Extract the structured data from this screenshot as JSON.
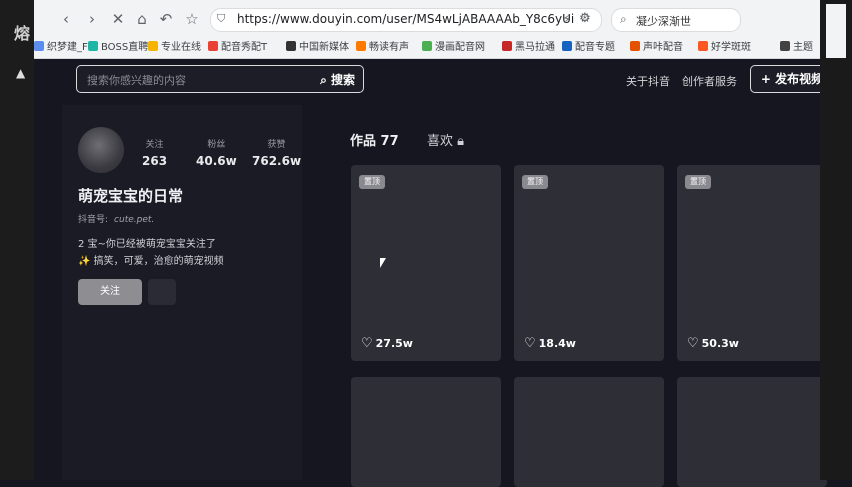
{
  "browser": {
    "url": "https://www.douyin.com/user/MS4wLjABAAAAb_Y8c6yUi",
    "search_text": "凝少深渐世",
    "left_title_glyph": "熔",
    "bookmarks": [
      {
        "label": "织梦建_F",
        "color": "#5b8def"
      },
      {
        "label": "BOSS直聘",
        "color": "#1db6a6"
      },
      {
        "label": "专业在线",
        "color": "#f4b400"
      },
      {
        "label": "配音秀配T",
        "color": "#e94235"
      },
      {
        "label": "中国新媒体",
        "color": "#333333"
      },
      {
        "label": "畅读有声",
        "color": "#ff7a00"
      },
      {
        "label": "漫画配音网",
        "color": "#4caf50"
      },
      {
        "label": "黑马拉通",
        "color": "#c62828"
      },
      {
        "label": "配音专题",
        "color": "#1565c0"
      },
      {
        "label": "声咔配音",
        "color": "#e65100"
      },
      {
        "label": "好学斑斑",
        "color": "#ff5722"
      },
      {
        "label": "主题",
        "color": "#424242"
      }
    ]
  },
  "site": {
    "search_placeholder": "搜索你感兴趣的内容",
    "search_button": "搜索",
    "about": "关于抖音",
    "creator": "创作者服务",
    "publish": "+ 发布视频"
  },
  "profile": {
    "stats": [
      {
        "label": "关注",
        "value": "263"
      },
      {
        "label": "粉丝",
        "value": "40.6w"
      },
      {
        "label": "获赞",
        "value": "762.6w"
      }
    ],
    "name": "萌宠宝宝的日常",
    "id_label": "抖音号:",
    "id_value": "cute.pet.",
    "bio_lines": [
      "2 宝~你已经被萌宠宝宝关注了",
      "✨ 搞笑，可爱，治愈的萌宠视频"
    ],
    "follow_button": "关注"
  },
  "tabs": {
    "works": "作品 77",
    "likes": "喜欢"
  },
  "videos": [
    {
      "badge": "置顶",
      "likes": "27.5w"
    },
    {
      "badge": "置顶",
      "likes": "18.4w"
    },
    {
      "badge": "置顶",
      "likes": "50.3w"
    },
    {
      "badge": "",
      "likes": ""
    },
    {
      "badge": "",
      "likes": ""
    },
    {
      "badge": "",
      "likes": ""
    }
  ]
}
